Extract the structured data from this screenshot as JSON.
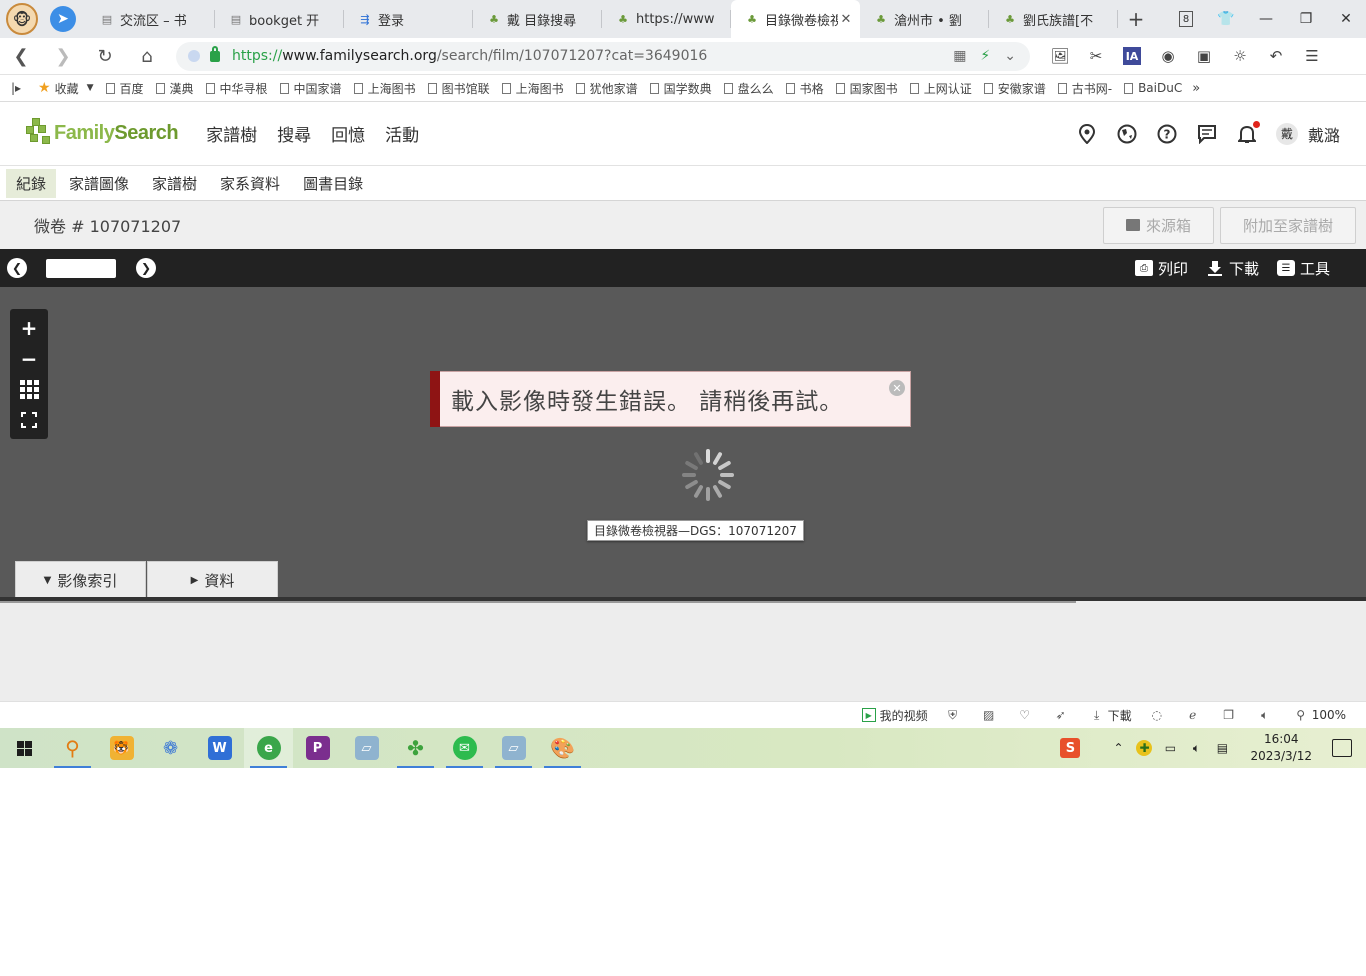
{
  "browser": {
    "tabs": [
      {
        "title": "交流区 – 书",
        "icon": "book-icon",
        "active": false
      },
      {
        "title": "bookget 开",
        "icon": "book-icon",
        "active": false
      },
      {
        "title": "登录",
        "icon": "login-icon",
        "active": false
      },
      {
        "title": "戴 目錄搜尋",
        "icon": "tree-icon",
        "active": false
      },
      {
        "title": "https://www",
        "icon": "tree-icon",
        "active": false
      },
      {
        "title": "目錄微卷檢視",
        "icon": "tree-icon",
        "active": true
      },
      {
        "title": "滄州市 • 劉",
        "icon": "tree-icon",
        "active": false
      },
      {
        "title": "劉氏族譜[不",
        "icon": "tree-icon",
        "active": false
      }
    ],
    "tab_count": "8",
    "url": {
      "scheme": "https://",
      "host": "www.familysearch.org",
      "path": "/search/film/107071207?cat=3649016"
    },
    "bookmarks": {
      "favorites_label": "收藏",
      "items": [
        "百度",
        "漢典",
        "中华寻根",
        "中国家谱",
        "上海图书",
        "图书馆联",
        "上海图书",
        "犹他家谱",
        "国学数典",
        "盘么么",
        "书格",
        "国家图书",
        "上网认证",
        "安徽家谱",
        "古书网-",
        "BaiDuC"
      ],
      "more": "»"
    }
  },
  "fs": {
    "logo_text_light": "Family",
    "logo_text_dark": "Search",
    "nav": [
      "家譜樹",
      "搜尋",
      "回憶",
      "活動"
    ],
    "user_initial": "戴",
    "user_name": "戴潞",
    "subnav": [
      "紀錄",
      "家譜圖像",
      "家譜樹",
      "家系資料",
      "圖書目錄"
    ],
    "film_title": "微卷 # 107071207",
    "source_box_label": "來源箱",
    "attach_label": "附加至家譜樹",
    "toolbar": {
      "print_label": "列印",
      "download_label": "下載",
      "tools_label": "工具"
    },
    "error_message": "載入影像時發生錯誤。 請稍後再試。",
    "viewer_caption": "目錄微卷檢視器—DGS：107071207",
    "panel_tabs": {
      "image_index": "影像索引",
      "info": "資料"
    }
  },
  "statusbar": {
    "video_label": "我的视频",
    "download_label": "下載",
    "zoom_label": "100%"
  },
  "taskbar": {
    "time": "16:04",
    "date": "2023/3/12",
    "ime_label": "S"
  },
  "colors": {
    "brand_green": "#8cb84a",
    "error_red": "#8e1414",
    "viewer_bg": "#595959",
    "toolbar_bg": "#222222"
  }
}
